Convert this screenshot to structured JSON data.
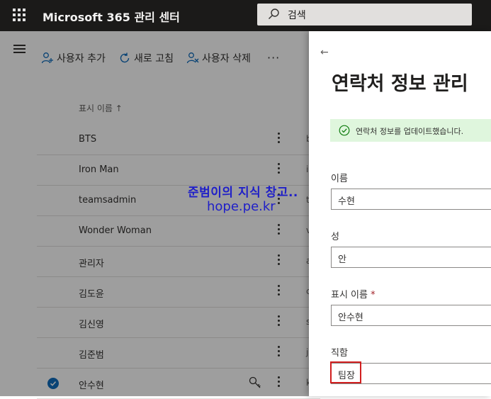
{
  "header": {
    "app_title": "Microsoft 365 관리 센터",
    "search_placeholder": "검색"
  },
  "commands": {
    "add_user": "사용자 추가",
    "refresh": "새로 고침",
    "delete_user": "사용자 삭제",
    "more": "···"
  },
  "list": {
    "column_display_name": "표시 이름 ↑",
    "rows": [
      {
        "name": "BTS",
        "cut": "b"
      },
      {
        "name": "Iron Man",
        "cut": "i"
      },
      {
        "name": "teamsadmin",
        "cut": "t"
      },
      {
        "name": "Wonder Woman",
        "cut": "v"
      },
      {
        "name": "관리자",
        "cut": "a"
      },
      {
        "name": "김도윤",
        "cut": "c"
      },
      {
        "name": "김신영",
        "cut": "s"
      },
      {
        "name": "김준범",
        "cut": "j"
      },
      {
        "name": "안수현",
        "cut": "k",
        "selected": true
      }
    ]
  },
  "watermark": {
    "line1": "준범이의 지식 창고..",
    "line2": "hope.pe.kr"
  },
  "panel": {
    "back": "←",
    "title": "연락처 정보 관리",
    "success_message": "연락처 정보를 업데이트했습니다.",
    "fields": {
      "first_name_label": "이름",
      "first_name_value": "수현",
      "last_name_label": "성",
      "last_name_value": "안",
      "display_name_label": "표시 이름",
      "required_mark": "*",
      "display_name_value": "안수현",
      "job_title_label": "직함",
      "job_title_value": "팀장"
    }
  },
  "colors": {
    "topbar": "#1b1a19",
    "success_bg": "#dff6dd",
    "highlight": "#d11f1f",
    "accent": "#0f6cbd"
  }
}
